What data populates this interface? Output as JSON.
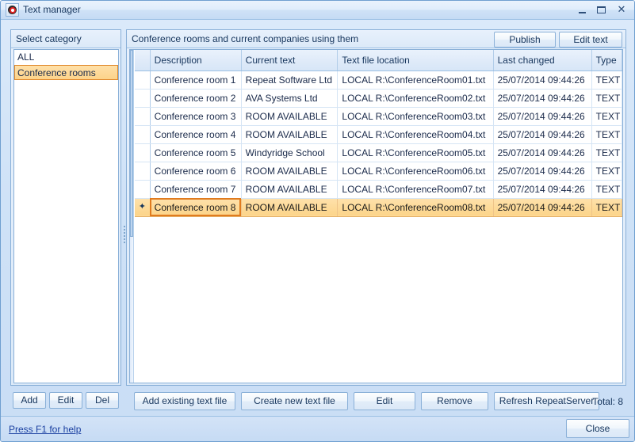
{
  "window": {
    "title": "Text manager",
    "app_icon": "target-ring-icon",
    "controls": {
      "minimize": "minimize-icon",
      "maximize": "maximize-icon",
      "close": "close-icon",
      "close_glyph": "✕"
    }
  },
  "left_panel": {
    "header": "Select category",
    "items": [
      {
        "label": "ALL",
        "selected": false
      },
      {
        "label": "Conference rooms",
        "selected": true
      }
    ],
    "buttons": [
      {
        "id": "add",
        "label": "Add"
      },
      {
        "id": "edit",
        "label": "Edit"
      },
      {
        "id": "del",
        "label": "Del"
      }
    ]
  },
  "right_panel": {
    "header": "Conference rooms and current companies using them",
    "header_buttons": [
      {
        "id": "publish",
        "label": "Publish"
      },
      {
        "id": "edit_text",
        "label": "Edit text"
      }
    ],
    "grid": {
      "columns": [
        "Description",
        "Current text",
        "Text file location",
        "Last changed",
        "Type"
      ],
      "row_indicator_glyph": "✦",
      "rows": [
        {
          "description": "Conference room 1",
          "current_text": "Repeat Software Ltd",
          "text_file_location": "LOCAL R:\\ConferenceRoom01.txt",
          "last_changed": "25/07/2014 09:44:26",
          "type": "TEXT",
          "selected": false
        },
        {
          "description": "Conference room 2",
          "current_text": "AVA Systems Ltd",
          "text_file_location": "LOCAL R:\\ConferenceRoom02.txt",
          "last_changed": "25/07/2014 09:44:26",
          "type": "TEXT",
          "selected": false
        },
        {
          "description": "Conference room 3",
          "current_text": "ROOM AVAILABLE",
          "text_file_location": "LOCAL R:\\ConferenceRoom03.txt",
          "last_changed": "25/07/2014 09:44:26",
          "type": "TEXT",
          "selected": false
        },
        {
          "description": "Conference room 4",
          "current_text": "ROOM AVAILABLE",
          "text_file_location": "LOCAL R:\\ConferenceRoom04.txt",
          "last_changed": "25/07/2014 09:44:26",
          "type": "TEXT",
          "selected": false
        },
        {
          "description": "Conference room 5",
          "current_text": "Windyridge School",
          "text_file_location": "LOCAL R:\\ConferenceRoom05.txt",
          "last_changed": "25/07/2014 09:44:26",
          "type": "TEXT",
          "selected": false
        },
        {
          "description": "Conference room 6",
          "current_text": "ROOM AVAILABLE",
          "text_file_location": "LOCAL R:\\ConferenceRoom06.txt",
          "last_changed": "25/07/2014 09:44:26",
          "type": "TEXT",
          "selected": false
        },
        {
          "description": "Conference room 7",
          "current_text": "ROOM AVAILABLE",
          "text_file_location": "LOCAL R:\\ConferenceRoom07.txt",
          "last_changed": "25/07/2014 09:44:26",
          "type": "TEXT",
          "selected": false
        },
        {
          "description": "Conference room 8",
          "current_text": "ROOM AVAILABLE",
          "text_file_location": "LOCAL R:\\ConferenceRoom08.txt",
          "last_changed": "25/07/2014 09:44:26",
          "type": "TEXT",
          "selected": true
        }
      ]
    },
    "buttons": [
      {
        "id": "add_existing",
        "label": "Add existing text file"
      },
      {
        "id": "create_new",
        "label": "Create new text file"
      },
      {
        "id": "edit",
        "label": "Edit"
      },
      {
        "id": "remove",
        "label": "Remove"
      },
      {
        "id": "refresh",
        "label": "Refresh RepeatServer"
      }
    ],
    "total_label": "Total: 8"
  },
  "statusbar": {
    "help_link": "Press F1 for help",
    "close_button": "Close"
  },
  "colors": {
    "accent_blue": "#17365d",
    "selection_orange": "#fcd489",
    "selection_border": "#e07b1f",
    "link_blue": "#1a3fa0",
    "panel_border": "#8ab0d8"
  }
}
